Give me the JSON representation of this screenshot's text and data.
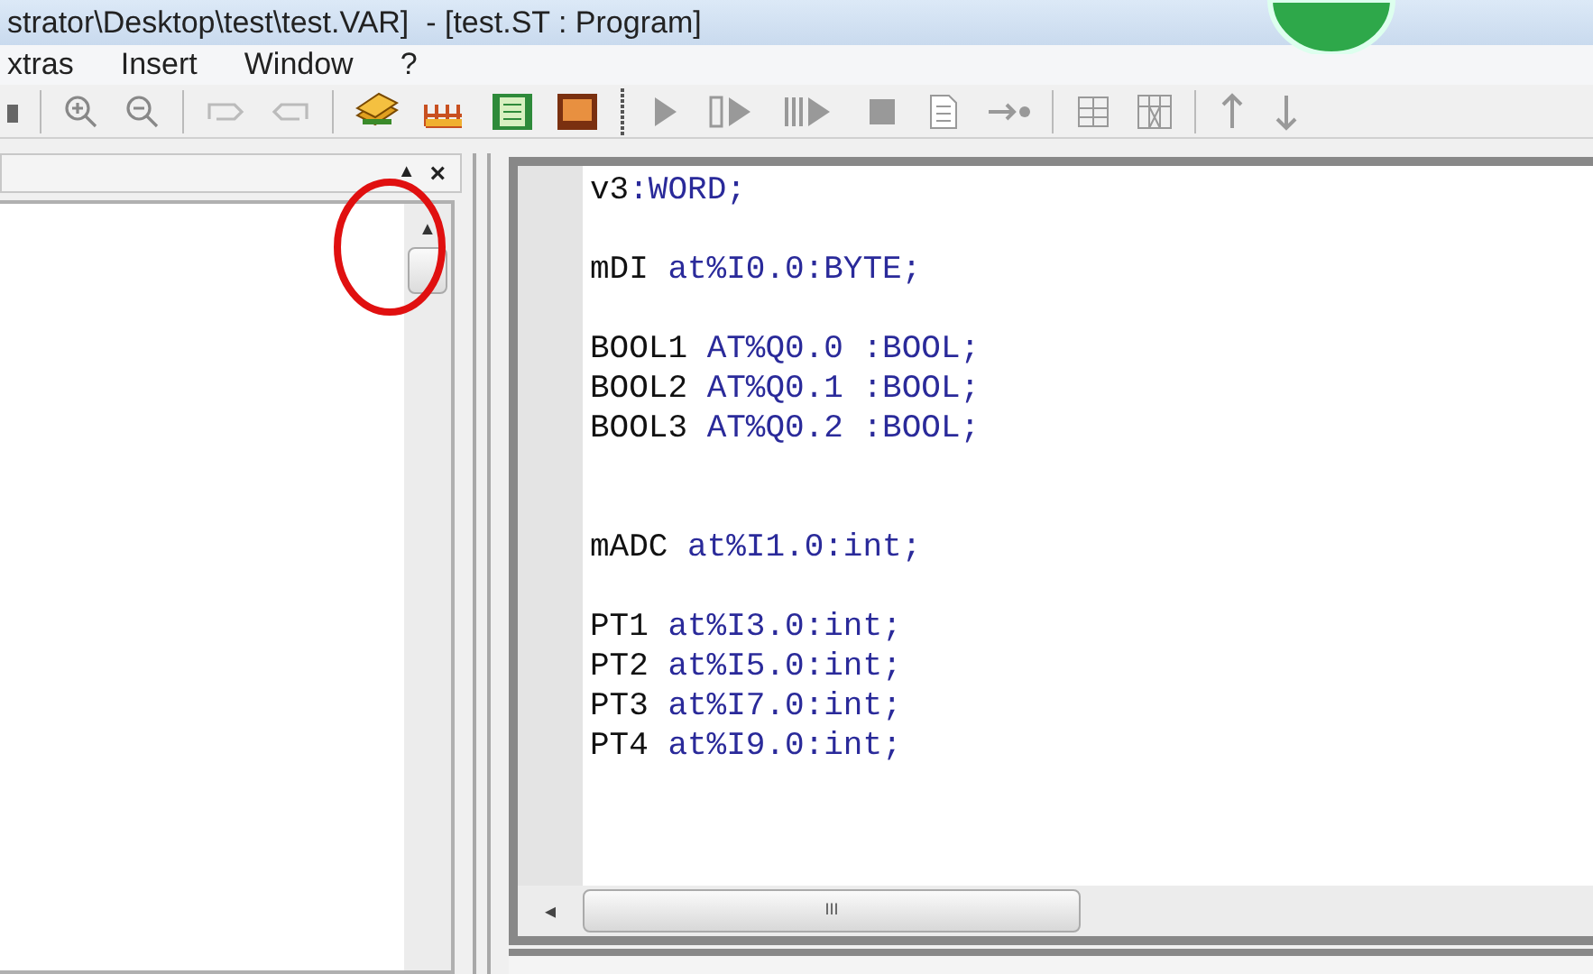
{
  "window": {
    "title": "strator\\Desktop\\test\\test.VAR]  - [test.ST : Program]"
  },
  "menu": [
    "xtras",
    "Insert",
    "Window",
    "?"
  ],
  "side_panel": {
    "collapse_glyph": "▲",
    "close_glyph": "×",
    "scroll_up_glyph": "▲"
  },
  "editor": {
    "lines": [
      {
        "kind": "code",
        "name": "v3",
        "rest": ":WORD;"
      },
      {
        "kind": "blank"
      },
      {
        "kind": "code",
        "name": "mDI",
        "rest": " at%I0.0:BYTE;"
      },
      {
        "kind": "blank"
      },
      {
        "kind": "code",
        "name": "BOOL1",
        "rest": " AT%Q0.0 :BOOL;"
      },
      {
        "kind": "code",
        "name": "BOOL2",
        "rest": " AT%Q0.1 :BOOL;"
      },
      {
        "kind": "code",
        "name": "BOOL3",
        "rest": " AT%Q0.2 :BOOL;"
      },
      {
        "kind": "blank"
      },
      {
        "kind": "blank"
      },
      {
        "kind": "code",
        "name": "mADC",
        "rest": " at%I1.0:int;"
      },
      {
        "kind": "blank"
      },
      {
        "kind": "code",
        "name": "PT1",
        "rest": " at%I3.0:int;"
      },
      {
        "kind": "code",
        "name": "PT2",
        "rest": " at%I5.0:int;"
      },
      {
        "kind": "code",
        "name": "PT3",
        "rest": " at%I7.0:int;"
      },
      {
        "kind": "code",
        "name": "PT4",
        "rest": " at%I9.0:int;"
      }
    ],
    "hscroll_left_glyph": "◂",
    "hscroll_grip": "III"
  }
}
